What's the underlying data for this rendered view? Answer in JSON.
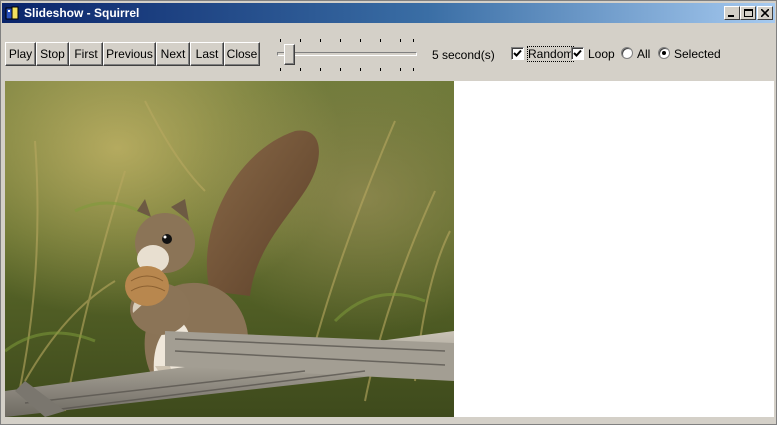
{
  "window": {
    "title": "Slideshow - Squirrel",
    "controls": [
      "minimize",
      "maximize",
      "close"
    ]
  },
  "toolbar": {
    "buttons": [
      {
        "label": "Play"
      },
      {
        "label": "Stop"
      },
      {
        "label": "First"
      },
      {
        "label": "Previous"
      },
      {
        "label": "Next"
      },
      {
        "label": "Last"
      },
      {
        "label": "Close"
      }
    ],
    "interval": {
      "label": "5 second(s)",
      "value_seconds": 5
    },
    "options": {
      "random": {
        "label": "Random",
        "checked": true
      },
      "loop": {
        "label": "Loop",
        "checked": true
      },
      "scope": {
        "options": [
          {
            "label": "All",
            "selected": false
          },
          {
            "label": "Selected",
            "selected": true
          }
        ]
      }
    }
  },
  "image": {
    "subject_icon": "squirrel-photo"
  },
  "colors": {
    "title_start": "#0a246a",
    "title_end": "#a6caf0",
    "face": "#d4d0c8",
    "canvas": "#ffffff"
  }
}
